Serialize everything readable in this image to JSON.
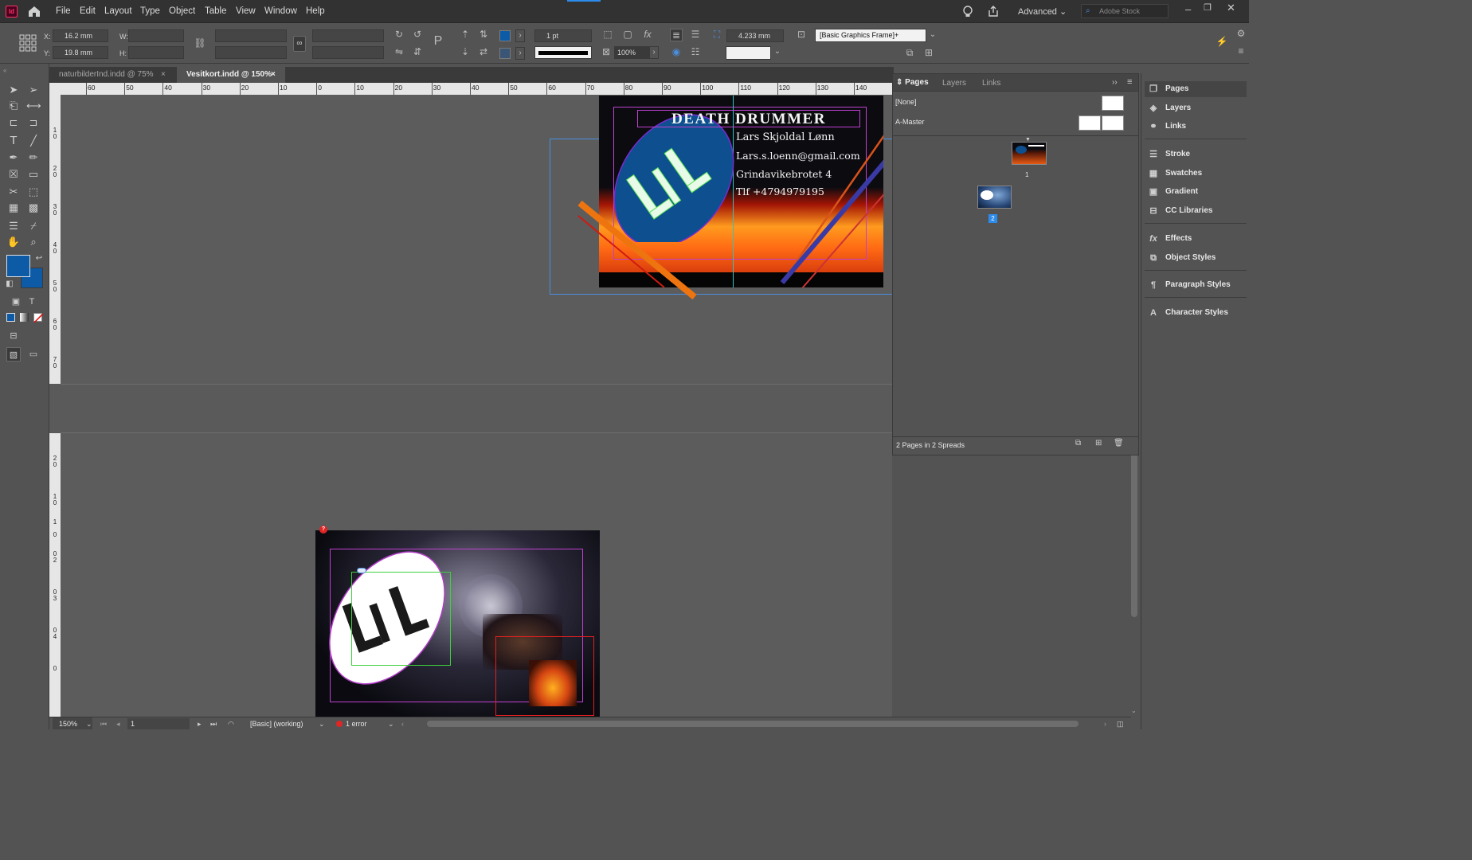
{
  "menubar": {
    "app_icon": "Id",
    "items": [
      "File",
      "Edit",
      "Layout",
      "Type",
      "Object",
      "Table",
      "View",
      "Window",
      "Help"
    ],
    "workspace": "Advanced",
    "search_placeholder": "Adobe Stock"
  },
  "control": {
    "x_label": "X:",
    "x_value": "16.2 mm",
    "y_label": "Y:",
    "y_value": "19.8 mm",
    "w_label": "W:",
    "h_label": "H:",
    "stroke_weight": "1 pt",
    "opacity": "100%",
    "offset_value": "4.233 mm",
    "object_style": "[Basic Graphics Frame]+"
  },
  "tabs": [
    {
      "label": "naturbilderInd.indd @ 75%",
      "close": "×"
    },
    {
      "label": "Vesitkort.indd @ 150%",
      "close": "×"
    }
  ],
  "ruler_h": [
    "60",
    "50",
    "40",
    "30",
    "20",
    "10",
    "0",
    "10",
    "20",
    "30",
    "40",
    "50",
    "60",
    "70",
    "80",
    "90",
    "100",
    "110",
    "120",
    "130",
    "140"
  ],
  "ruler_v_top": [
    "1",
    "0",
    "2",
    "0",
    "3",
    "0",
    "4",
    "0",
    "5",
    "0",
    "6",
    "0",
    "7",
    "0"
  ],
  "ruler_v_bottom": [
    "2",
    "0",
    "1",
    "0",
    "0",
    "1",
    "0",
    "2",
    "0",
    "3",
    "0",
    "4",
    "0"
  ],
  "card1": {
    "title": "DEATH DRUMMER",
    "name": "Lars Skjoldal Lønn",
    "email": "Lars.s.loenn@gmail.com",
    "address": "Grindavikebrotet 4",
    "phone": "Tlf +4794979195",
    "logo": "LSL"
  },
  "card2": {
    "logo": "LSL",
    "error_badge": "?"
  },
  "pages_panel": {
    "tabs": [
      "Pages",
      "Layers",
      "Links"
    ],
    "none_label": "[None]",
    "master_label": "A-Master",
    "page1_num": "1",
    "page2_num": "2",
    "footer": "2 Pages in 2 Spreads"
  },
  "dock": {
    "items": [
      "Pages",
      "Layers",
      "Links",
      "Stroke",
      "Swatches",
      "Gradient",
      "CC Libraries",
      "Effects",
      "Object Styles",
      "Paragraph Styles",
      "Character Styles"
    ]
  },
  "status": {
    "zoom": "150%",
    "page": "1",
    "preflight_profile": "[Basic] (working)",
    "errors": "1 error"
  },
  "colors": {
    "fill": "#0d5aa7",
    "accent": "#2d8ceb"
  }
}
